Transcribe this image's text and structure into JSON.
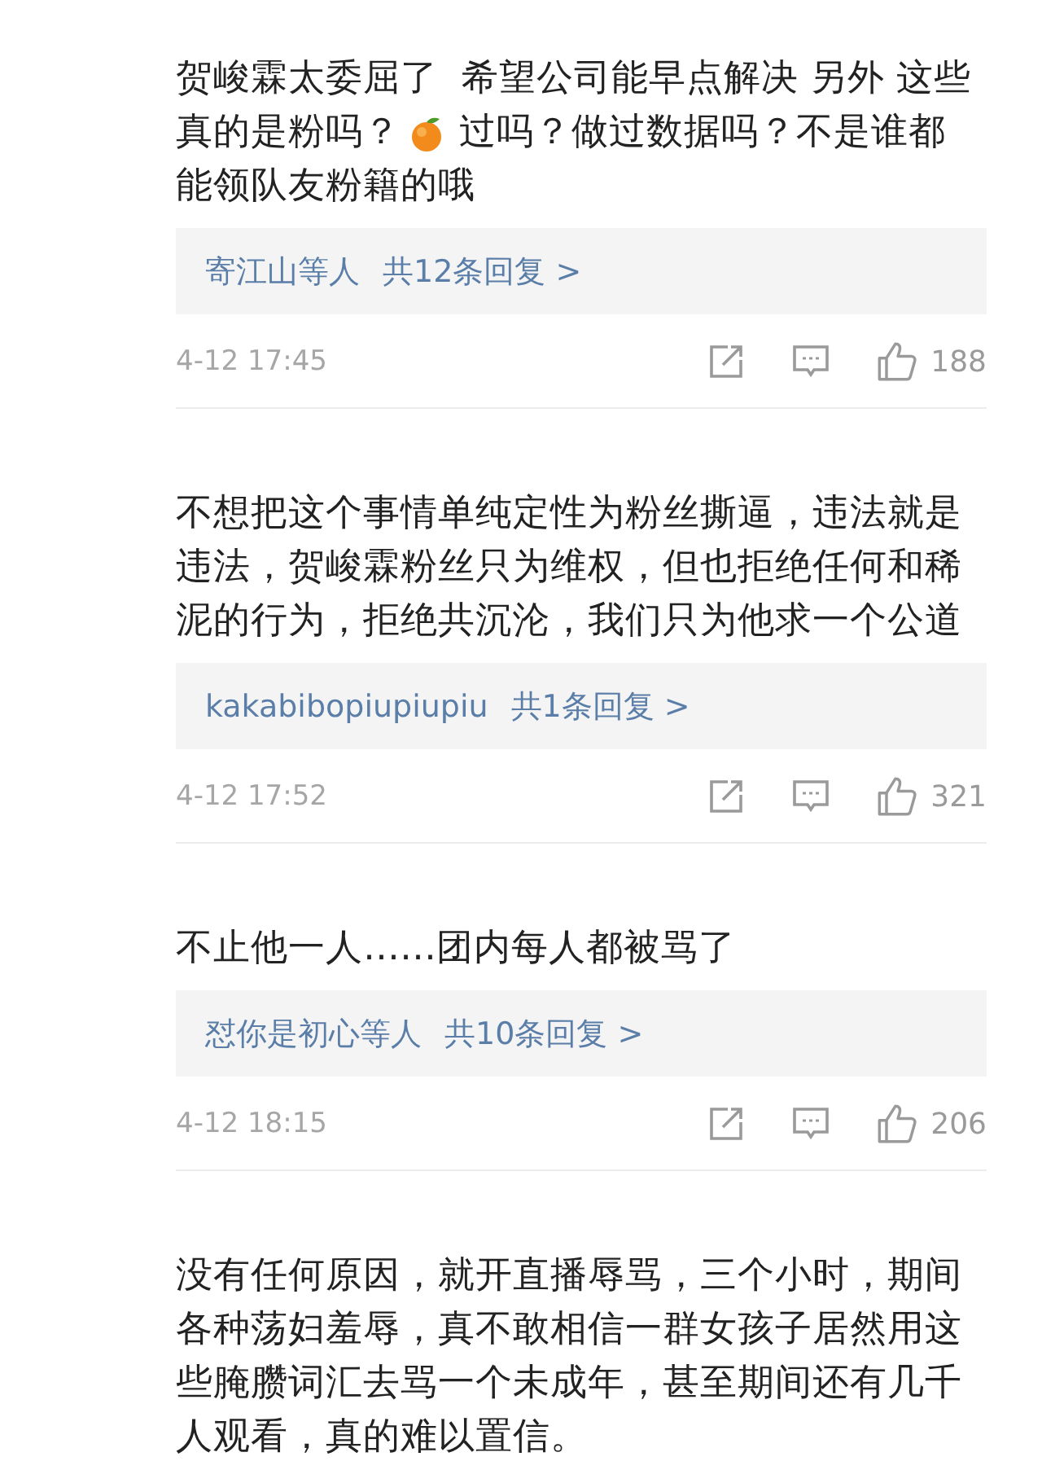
{
  "comments": [
    {
      "lines": [
        [
          {
            "kind": "text",
            "text": "贺峻霖太委屈了  希望公司能早点解决 另外 这些"
          }
        ],
        [
          {
            "kind": "text",
            "text": "真的是粉吗？"
          },
          {
            "kind": "emoji"
          },
          {
            "kind": "text",
            "text": "过吗？做过数据吗？不是谁都"
          }
        ],
        [
          {
            "kind": "text",
            "text": "能领队友粉籍的哦"
          }
        ]
      ],
      "replies": {
        "names": "寄江山等人",
        "count": "共12条回复 >"
      },
      "time": "4-12 17:45",
      "likes": "188"
    },
    {
      "lines": [
        [
          {
            "kind": "text",
            "text": "不想把这个事情单纯定性为粉丝撕逼，违法就是违法，贺峻霖粉丝只为维权，但也拒绝任何和稀泥的行为，拒绝共沉沦，我们只为他求一个公道"
          }
        ]
      ],
      "replies": {
        "names": "kakabibopiupiupiu",
        "count": "共1条回复 >"
      },
      "time": "4-12 17:52",
      "likes": "321"
    },
    {
      "lines": [
        [
          {
            "kind": "text",
            "text": "不止他一人……团内每人都被骂了"
          }
        ]
      ],
      "replies": {
        "names": "怼你是初心等人",
        "count": "共10条回复 >"
      },
      "time": "4-12 18:15",
      "likes": "206"
    },
    {
      "lines": [
        [
          {
            "kind": "text",
            "text": "没有任何原因，就开直播辱骂，三个小时，期间各种荡妇羞辱，真不敢相信一群女孩子居然用这些腌臜词汇去骂一个未成年，甚至期间还有几千人观看，真的难以置信。"
          }
        ]
      ]
    }
  ]
}
